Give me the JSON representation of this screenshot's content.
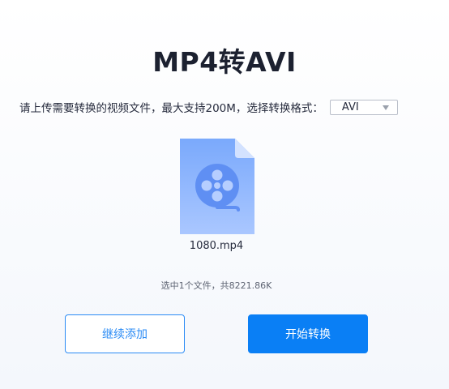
{
  "header": {
    "title": "MP4转AVI"
  },
  "upload": {
    "instruction": "请上传需要转换的视频文件，最大支持200M，选择转换格式：",
    "format_select": {
      "selected": "AVI"
    }
  },
  "file": {
    "icon": "video-file-icon",
    "name": "1080.mp4"
  },
  "summary": {
    "text": "选中1个文件，共8221.86K"
  },
  "actions": {
    "add_more_label": "继续添加",
    "start_label": "开始转换"
  },
  "colors": {
    "accent": "#0a7ff5",
    "file_icon_top": "#7aa9fc",
    "file_icon_bottom": "#aac7ff",
    "title": "#1c2130"
  }
}
